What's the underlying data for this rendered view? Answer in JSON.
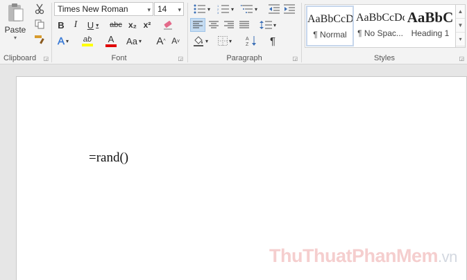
{
  "clipboard": {
    "paste_label": "Paste",
    "group_label": "Clipboard"
  },
  "font": {
    "font_name": "Times New Roman",
    "font_size": "14",
    "group_label": "Font",
    "bold": "B",
    "italic": "I",
    "underline": "U",
    "strikethrough": "abc",
    "subscript": "x₂",
    "superscript": "x²",
    "text_effects": "A",
    "highlight": "ab",
    "font_color": "A",
    "change_case": "Aa",
    "grow_font": "A",
    "shrink_font": "A",
    "colors": {
      "highlight": "#ffff00",
      "font_color": "#e00000",
      "effects": "#3b7bd6"
    }
  },
  "paragraph": {
    "group_label": "Paragraph",
    "show_marks": "¶"
  },
  "styles": {
    "group_label": "Styles",
    "tiles": [
      {
        "preview": "AaBbCcDc",
        "name": "¶ Normal"
      },
      {
        "preview": "AaBbCcDc",
        "name": "¶ No Spac..."
      },
      {
        "preview": "AaBbC",
        "name": "Heading 1"
      }
    ]
  },
  "document": {
    "text": "=rand()"
  },
  "watermark": {
    "text": "ThuThuatPhanMem",
    "suffix": ".vn"
  }
}
